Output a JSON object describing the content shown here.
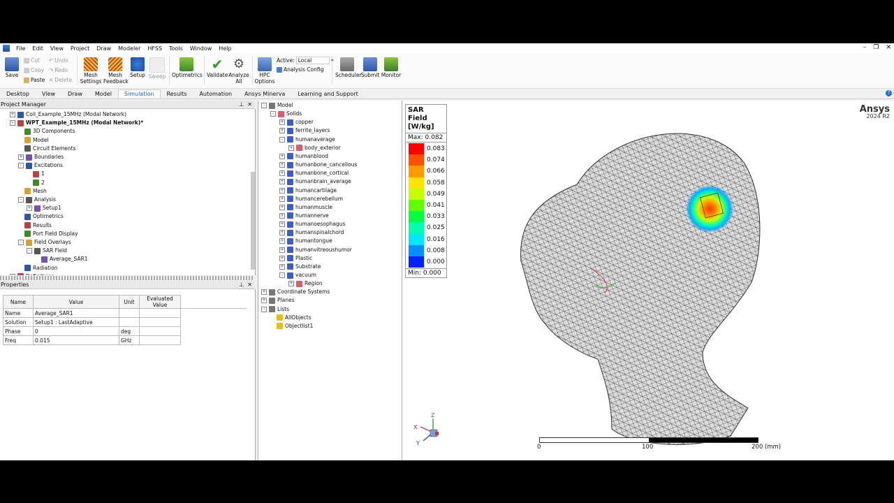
{
  "menu": [
    "File",
    "Edit",
    "View",
    "Project",
    "Draw",
    "Modeler",
    "HFSS",
    "Tools",
    "Window",
    "Help"
  ],
  "ribbon": {
    "save": "Save",
    "cut": "Cut",
    "copy": "Copy",
    "paste": "Paste",
    "undo": "Undo",
    "redo": "Redo",
    "delete": "Delete",
    "mesh_settings_1": "Mesh",
    "mesh_settings_2": "Settings",
    "mesh_feedback_1": "Mesh",
    "mesh_feedback_2": "Feedback",
    "setup": "Setup",
    "sweep": "Sweep",
    "optimetrics": "Optimetrics",
    "validate": "Validate",
    "analyze_1": "Analyze",
    "analyze_2": "All",
    "hpc_1": "HPC",
    "hpc_2": "Options",
    "active_label": "Active:",
    "active_value": "Local",
    "analysis_config": "Analysis Config",
    "scheduler": "Scheduler",
    "submit": "Submit",
    "monitor": "Monitor"
  },
  "tabs": [
    "Desktop",
    "View",
    "Draw",
    "Model",
    "Simulation",
    "Results",
    "Automation",
    "Ansys Minerva",
    "Learning and Support"
  ],
  "active_tab": "Simulation",
  "project_manager": {
    "title": "Project Manager",
    "items": [
      {
        "label": "Coil_Example_15MHz (Modal Network)",
        "indent": 0,
        "box": "+",
        "bold": false
      },
      {
        "label": "WPT_Example_15MHz (Modal Network)*",
        "indent": 0,
        "box": "-",
        "bold": true
      },
      {
        "label": "3D Components",
        "indent": 1,
        "box": "",
        "bold": false
      },
      {
        "label": "Model",
        "indent": 1,
        "box": "",
        "bold": false
      },
      {
        "label": "Circuit Elements",
        "indent": 1,
        "box": "",
        "bold": false
      },
      {
        "label": "Boundaries",
        "indent": 1,
        "box": "+",
        "bold": false
      },
      {
        "label": "Excitations",
        "indent": 1,
        "box": "-",
        "bold": false
      },
      {
        "label": "1",
        "indent": 2,
        "box": "",
        "bold": false
      },
      {
        "label": "2",
        "indent": 2,
        "box": "",
        "bold": false
      },
      {
        "label": "Mesh",
        "indent": 1,
        "box": "",
        "bold": false
      },
      {
        "label": "Analysis",
        "indent": 1,
        "box": "-",
        "bold": false
      },
      {
        "label": "Setup1",
        "indent": 2,
        "box": "+",
        "bold": false
      },
      {
        "label": "Optimetrics",
        "indent": 1,
        "box": "",
        "bold": false
      },
      {
        "label": "Results",
        "indent": 1,
        "box": "",
        "bold": false
      },
      {
        "label": "Port Field Display",
        "indent": 1,
        "box": "",
        "bold": false
      },
      {
        "label": "Field Overlays",
        "indent": 1,
        "box": "-",
        "bold": false
      },
      {
        "label": "SAR Field",
        "indent": 2,
        "box": "-",
        "bold": false
      },
      {
        "label": "Average_SAR1",
        "indent": 3,
        "box": "",
        "bold": false
      },
      {
        "label": "Radiation",
        "indent": 1,
        "box": "",
        "bold": false
      },
      {
        "label": "Definitions",
        "indent": 0,
        "box": "+",
        "bold": false
      }
    ]
  },
  "properties": {
    "title": "Properties",
    "headers": [
      "Name",
      "Value",
      "Unit",
      "Evaluated Value"
    ],
    "rows": [
      [
        "Name",
        "Average_SAR1",
        "",
        ""
      ],
      [
        "Solution",
        "Setup1 : LastAdaptive",
        "",
        ""
      ],
      [
        "Phase",
        "0",
        "deg",
        ""
      ],
      [
        "Freq",
        "0.015",
        "GHz",
        ""
      ]
    ]
  },
  "model_tree": {
    "items": [
      {
        "label": "Model",
        "indent": 0,
        "box": "-"
      },
      {
        "label": "Solids",
        "indent": 1,
        "box": "-"
      },
      {
        "label": "copper",
        "indent": 2,
        "box": "+"
      },
      {
        "label": "ferrite_layers",
        "indent": 2,
        "box": "+"
      },
      {
        "label": "humanaverage",
        "indent": 2,
        "box": "-"
      },
      {
        "label": "body_exterior",
        "indent": 3,
        "box": "+"
      },
      {
        "label": "humanblood",
        "indent": 2,
        "box": "+"
      },
      {
        "label": "humanbone_cancellous",
        "indent": 2,
        "box": "+"
      },
      {
        "label": "humanbone_cortical",
        "indent": 2,
        "box": "+"
      },
      {
        "label": "humanbrain_average",
        "indent": 2,
        "box": "+"
      },
      {
        "label": "humancartilage",
        "indent": 2,
        "box": "+"
      },
      {
        "label": "humancerebellum",
        "indent": 2,
        "box": "+"
      },
      {
        "label": "humanmuscle",
        "indent": 2,
        "box": "+"
      },
      {
        "label": "humannerve",
        "indent": 2,
        "box": "+"
      },
      {
        "label": "humanoesophagus",
        "indent": 2,
        "box": "+"
      },
      {
        "label": "humanspinalchord",
        "indent": 2,
        "box": "+"
      },
      {
        "label": "humantongue",
        "indent": 2,
        "box": "+"
      },
      {
        "label": "humanvitreoushumor",
        "indent": 2,
        "box": "+"
      },
      {
        "label": "Plastic",
        "indent": 2,
        "box": "+"
      },
      {
        "label": "Substrate",
        "indent": 2,
        "box": "+"
      },
      {
        "label": "vacuum",
        "indent": 2,
        "box": "-"
      },
      {
        "label": "Region",
        "indent": 3,
        "box": "+"
      },
      {
        "label": "Coordinate Systems",
        "indent": 0,
        "box": "+"
      },
      {
        "label": "Planes",
        "indent": 0,
        "box": "+"
      },
      {
        "label": "Lists",
        "indent": 0,
        "box": "-"
      },
      {
        "label": "AllObjects",
        "indent": 1,
        "box": ""
      },
      {
        "label": "Objectlist1",
        "indent": 1,
        "box": ""
      }
    ]
  },
  "legend": {
    "title_1": "SAR Field",
    "title_2": "[W/kg]",
    "max": "Max: 0.082",
    "min": "Min: 0.000",
    "levels": [
      "0.083",
      "0.074",
      "0.066",
      "0.058",
      "0.049",
      "0.041",
      "0.033",
      "0.025",
      "0.016",
      "0.008",
      "0.000"
    ],
    "colors": [
      "#ff0000",
      "#ff5000",
      "#ff9a00",
      "#ffe600",
      "#c8ff00",
      "#60ff00",
      "#00ff40",
      "#00ffb0",
      "#00e8ff",
      "#0090ff",
      "#0020ff"
    ]
  },
  "brand": {
    "name": "Ansys",
    "version": "2024 R2"
  },
  "scale": {
    "labels": [
      "0",
      "100",
      "200 (mm)"
    ]
  },
  "axes": {
    "x": "X",
    "y": "Y",
    "z": "Z"
  }
}
